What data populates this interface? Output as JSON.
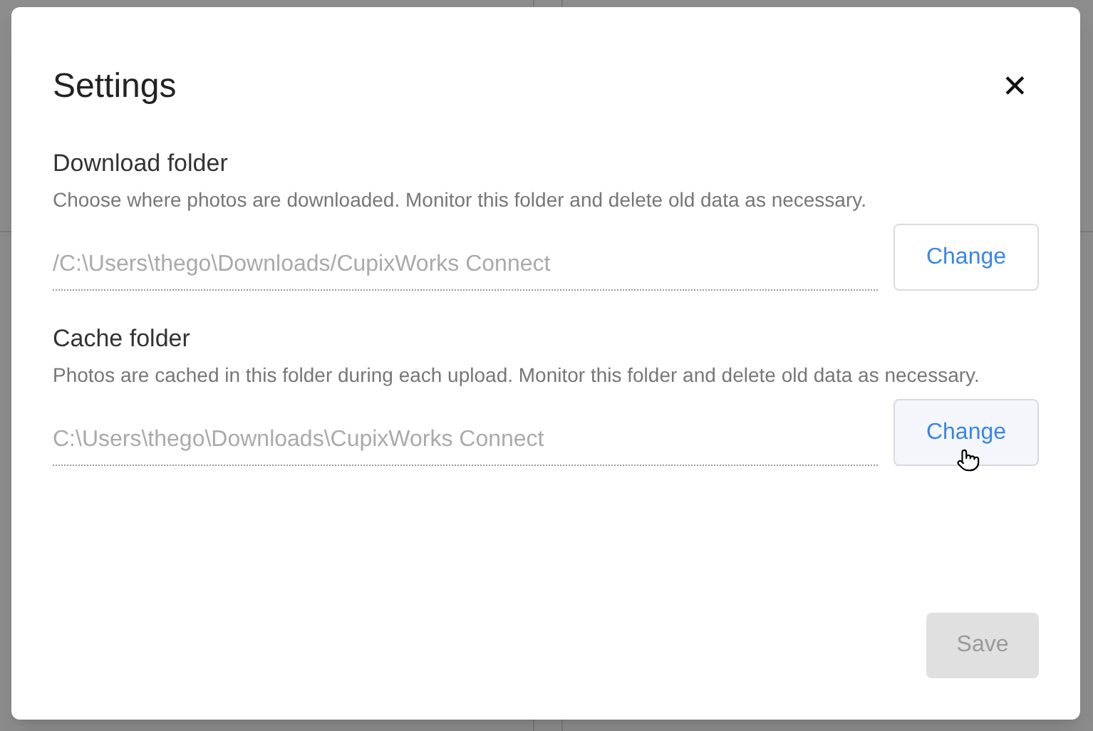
{
  "dialog": {
    "title": "Settings",
    "close": "✕",
    "sections": [
      {
        "label": "Download folder",
        "description": "Choose where photos are downloaded. Monitor this folder and delete old data as necessary.",
        "path": "/C:\\Users\\thego\\Downloads/CupixWorks Connect",
        "button": {
          "label": "Change",
          "hovered": false
        }
      },
      {
        "label": "Cache folder",
        "description": "Photos are cached in this folder during each upload. Monitor this folder and delete old data as necessary.",
        "path": "C:\\Users\\thego\\Downloads\\CupixWorks Connect",
        "button": {
          "label": "Change",
          "hovered": true
        }
      }
    ],
    "save": {
      "label": "Save",
      "disabled": true
    }
  }
}
